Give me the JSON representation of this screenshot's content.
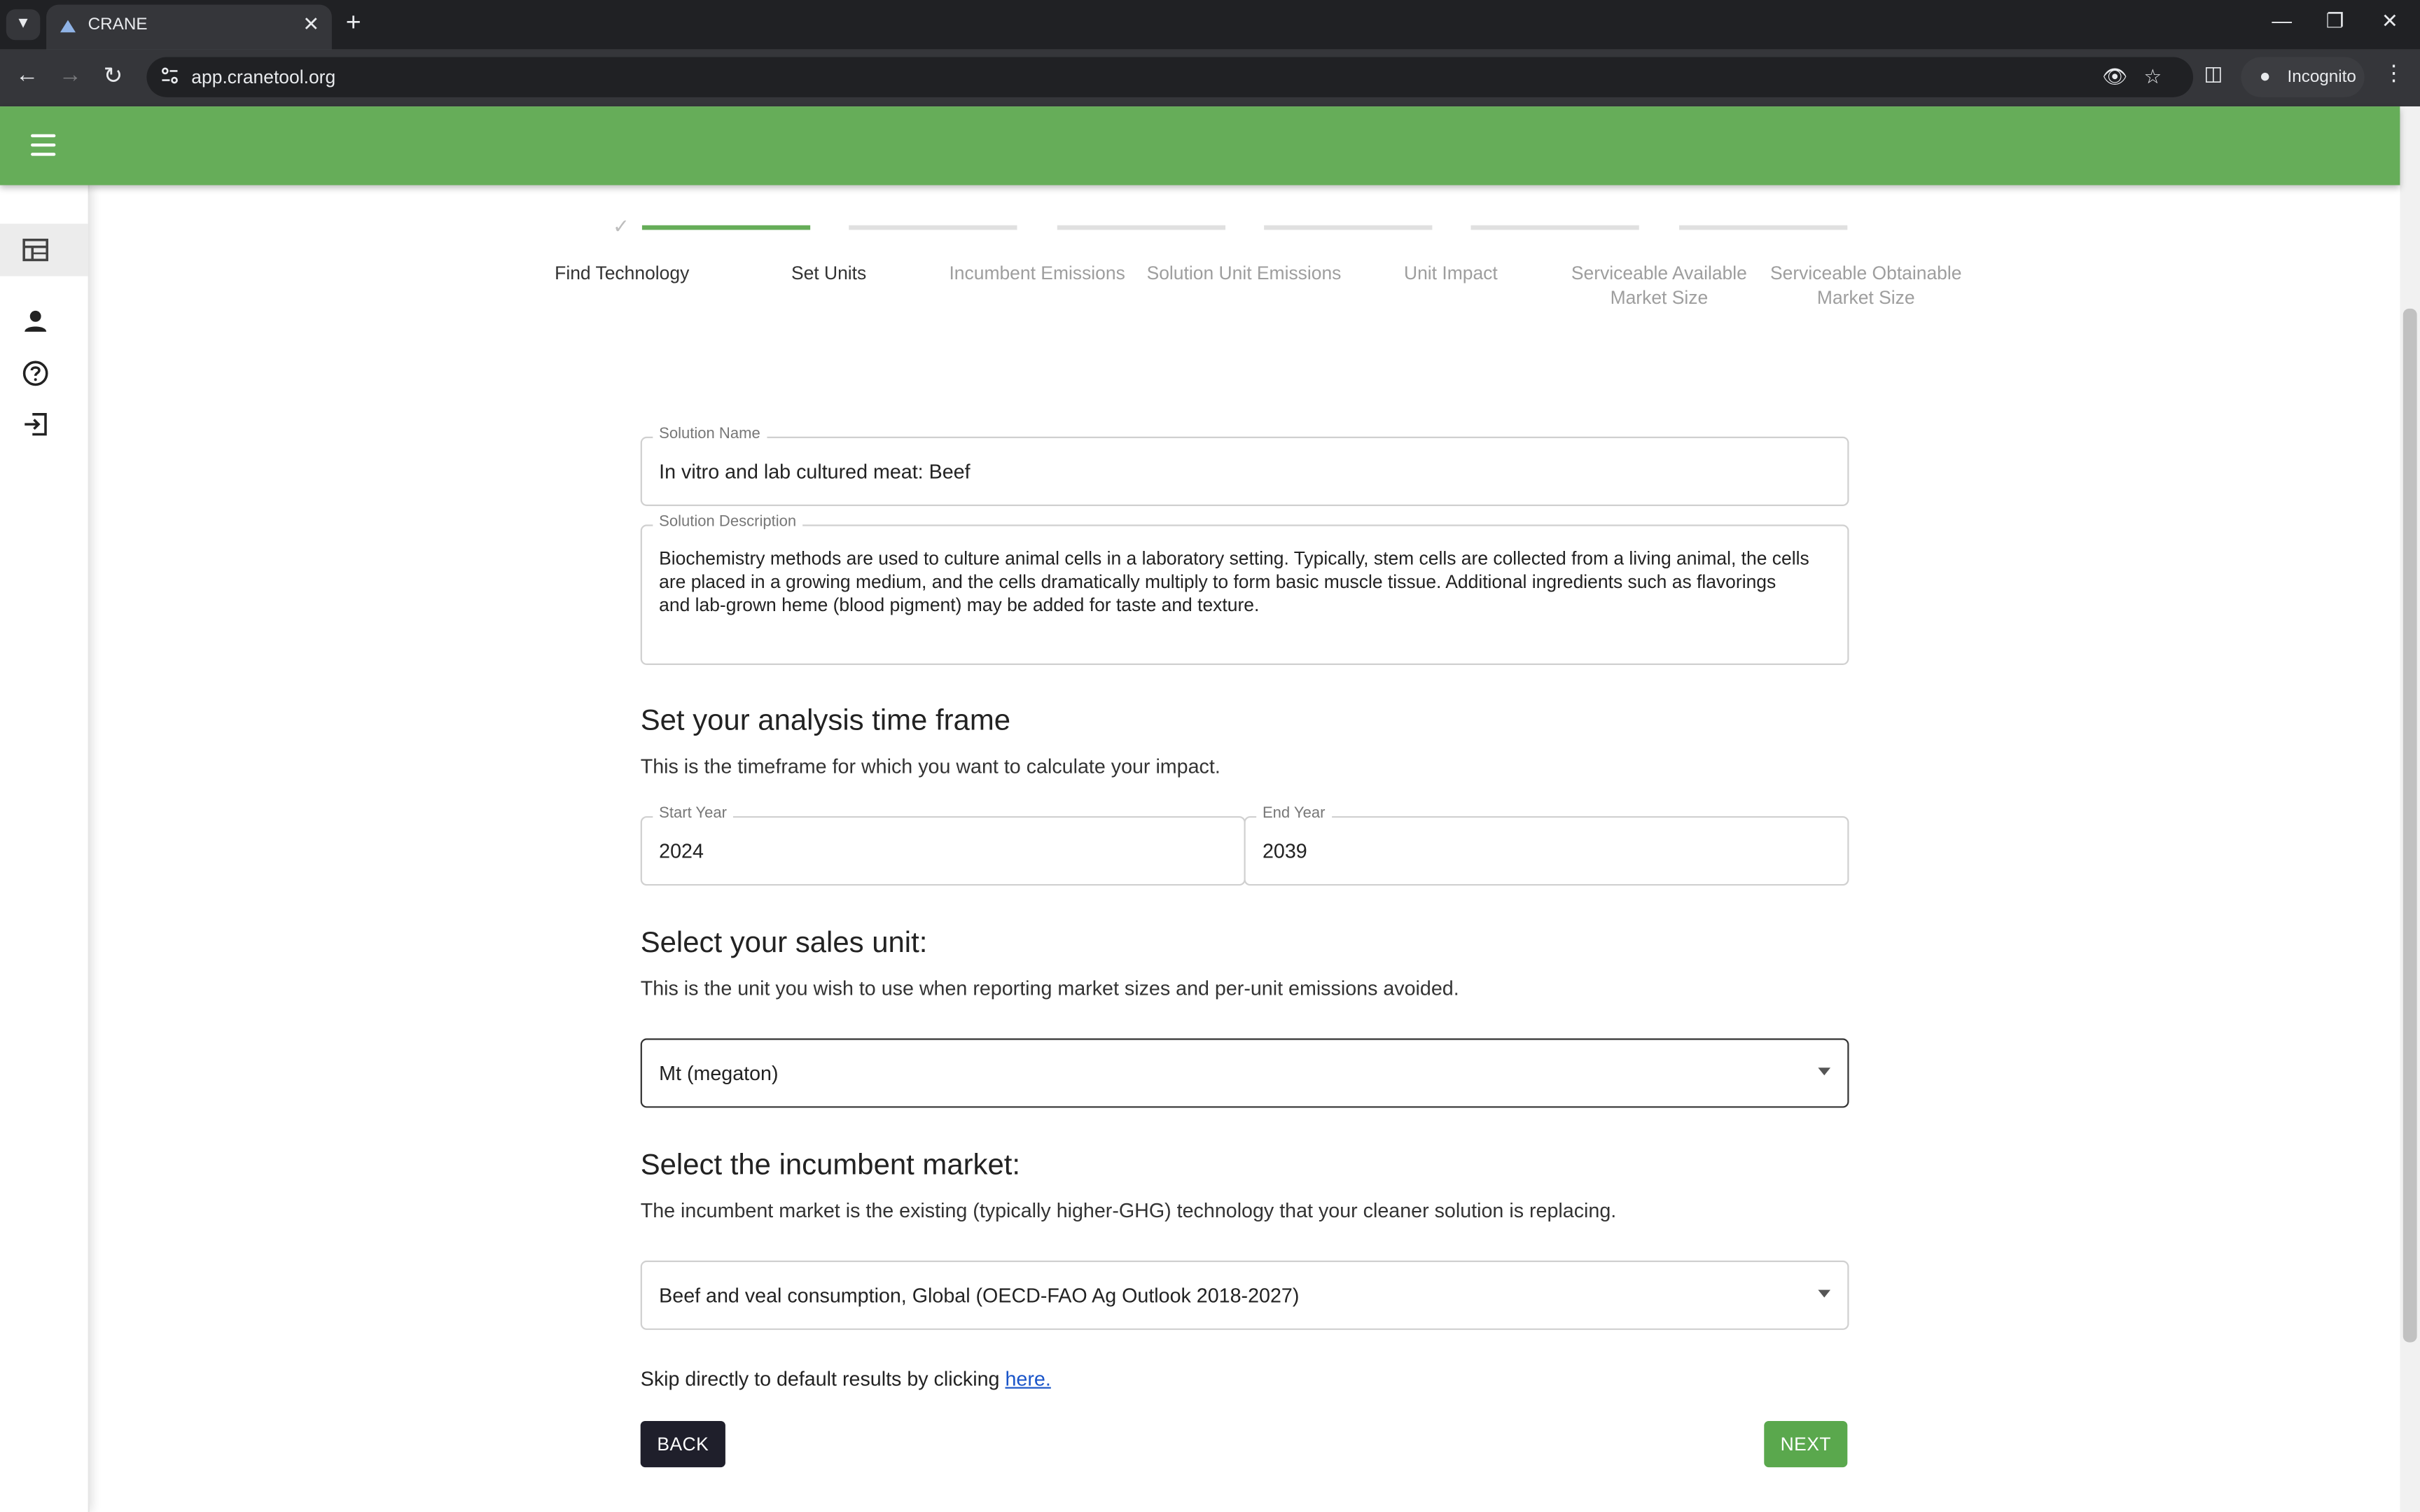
{
  "browser": {
    "tab_title": "CRANE",
    "url": "app.cranetool.org",
    "incognito_label": "Incognito"
  },
  "stepper": {
    "steps": [
      {
        "label": "Find Technology",
        "state": "done"
      },
      {
        "label": "Set Units",
        "state": "active"
      },
      {
        "label": "Incumbent Emissions",
        "state": "pending"
      },
      {
        "label": "Solution Unit Emissions",
        "state": "pending"
      },
      {
        "label": "Unit Impact",
        "state": "pending"
      },
      {
        "label": "Serviceable Available Market Size",
        "state": "pending"
      },
      {
        "label": "Serviceable Obtainable Market Size",
        "state": "pending"
      }
    ]
  },
  "form": {
    "solution_name": {
      "label": "Solution Name",
      "value": "In vitro and lab cultured meat: Beef"
    },
    "solution_description": {
      "label": "Solution Description",
      "value": "Biochemistry methods are used to culture animal cells in a laboratory setting. Typically, stem cells are collected from a living animal, the cells are placed in a growing medium, and the cells dramatically multiply to form basic muscle tissue. Additional ingredients such as flavorings and lab-grown heme (blood pigment) may be added for taste and texture."
    },
    "timeframe": {
      "title": "Set your analysis time frame",
      "subtitle": "This is the timeframe for which you want to calculate your impact.",
      "start_label": "Start Year",
      "start_value": "2024",
      "end_label": "End Year",
      "end_value": "2039"
    },
    "sales_unit": {
      "title": "Select your sales unit:",
      "subtitle": "This is the unit you wish to use when reporting market sizes and per-unit emissions avoided.",
      "selected": "Mt (megaton)"
    },
    "incumbent_market": {
      "title": "Select the incumbent market:",
      "subtitle": "The incumbent market is the existing (typically higher-GHG) technology that your cleaner solution is replacing.",
      "selected": "Beef and veal consumption, Global (OECD-FAO Ag Outlook 2018-2027)"
    },
    "skip": {
      "text": "Skip directly to default results by clicking ",
      "link": "here."
    },
    "back_label": "BACK",
    "next_label": "NEXT"
  },
  "colors": {
    "brand_green": "#66ad59",
    "next_button": "#5aa84d",
    "back_button": "#1f1f2b"
  }
}
